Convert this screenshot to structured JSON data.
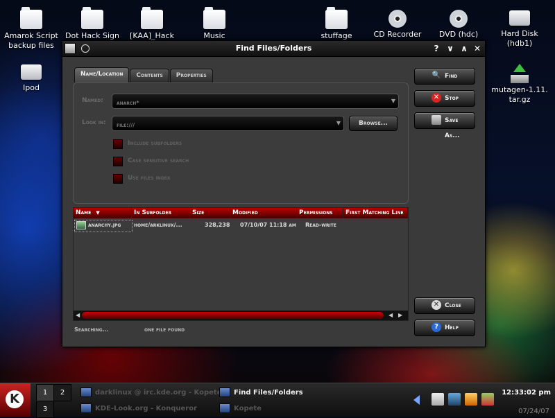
{
  "desktop": {
    "icons": [
      {
        "label": "Amarok Script backup files",
        "type": "folder"
      },
      {
        "label": "Dot Hack Sign",
        "type": "folder"
      },
      {
        "label": "[KAA]_Hack",
        "type": "folder"
      },
      {
        "label": "Music",
        "type": "folder"
      },
      {
        "label": "stuffage",
        "type": "folder"
      },
      {
        "label": "CD Recorder",
        "type": "cd-icon"
      },
      {
        "label": "DVD (hdc)",
        "type": "dvd-icon"
      },
      {
        "label": "Hard Disk (hdb1)",
        "type": "hard-disk-icon"
      },
      {
        "label": "Ipod",
        "type": "ipod-drive-icon"
      },
      {
        "label": "mutagen-1.11. tar.gz",
        "type": "package-icon"
      }
    ]
  },
  "window": {
    "title": "Find Files/Folders",
    "help_button": "?",
    "minimize_button": "∨",
    "maximize_button": "∧",
    "close_button": "✕"
  },
  "tabs": [
    "Name/Location",
    "Contents",
    "Properties"
  ],
  "form": {
    "named_label": "Named:",
    "named_value": "anarch*",
    "lookin_label": "Look in:",
    "lookin_value": "file:///",
    "browse_label": "Browse...",
    "checks": [
      "Include subfolders",
      "Case sensitive search",
      "Use files index"
    ]
  },
  "side_buttons": {
    "find": "Find",
    "stop": "Stop",
    "save_as": "Save As...",
    "close": "Close",
    "help": "Help"
  },
  "results": {
    "columns": [
      "Name",
      "In Subfolder",
      "Size",
      "Modified",
      "Permissions",
      "First Matching Line"
    ],
    "sort_indicator": "▼",
    "rows": [
      {
        "name": "anarchy.jpg",
        "folder": "home/arklinux/...",
        "size": "328,238",
        "modified": "07/10/07 11:18 am",
        "permissions": "Read-write",
        "first_line": ""
      }
    ]
  },
  "status": {
    "left": "Searching...",
    "right": "one file found"
  },
  "taskbar": {
    "desktops": [
      "1",
      "2",
      "3"
    ],
    "tasks": [
      {
        "label": "darklinux @ irc.kde.org - Kopete",
        "active": false
      },
      {
        "label": "Find Files/Folders",
        "active": true
      },
      {
        "label": "KDE-Look.org - Konqueror",
        "active": false
      },
      {
        "label": "Kopete",
        "active": false
      }
    ],
    "clock": "12:33:02 pm",
    "date": "07/24/07"
  },
  "colors": {
    "accent": "#b00000",
    "window_bg": "#3a3a3a",
    "titlebar": "#111111"
  }
}
